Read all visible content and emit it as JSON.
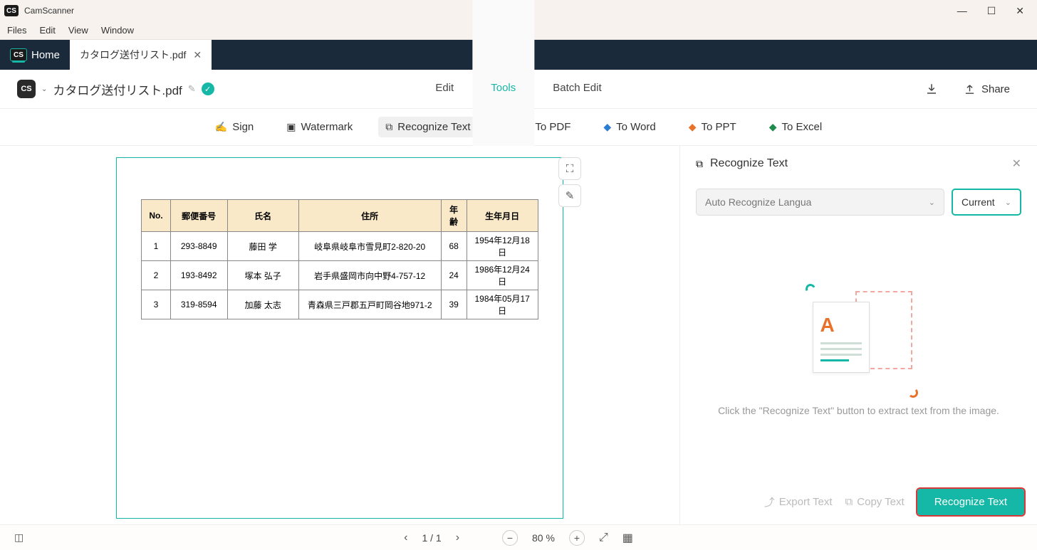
{
  "app": {
    "name": "CamScanner"
  },
  "menu": {
    "files": "Files",
    "edit": "Edit",
    "view": "View",
    "window": "Window"
  },
  "tabs": {
    "home": "Home",
    "doc": "カタログ送付リスト.pdf"
  },
  "toolbar": {
    "docTitle": "カタログ送付リスト.pdf",
    "edit": "Edit",
    "tools": "Tools",
    "batch": "Batch Edit",
    "share": "Share"
  },
  "ribbon": {
    "sign": "Sign",
    "watermark": "Watermark",
    "recognize": "Recognize Text",
    "toPdf": "To PDF",
    "toWord": "To Word",
    "toPpt": "To PPT",
    "toExcel": "To Excel"
  },
  "docTable": {
    "headers": {
      "no": "No.",
      "zip": "郵便番号",
      "name": "氏名",
      "addr": "住所",
      "age": "年齢",
      "dob": "生年月日"
    },
    "rows": [
      {
        "no": "1",
        "zip": "293-8849",
        "name": "藤田 学",
        "addr": "岐阜県岐阜市雪見町2-820-20",
        "age": "68",
        "dob": "1954年12月18日"
      },
      {
        "no": "2",
        "zip": "193-8492",
        "name": "塚本 弘子",
        "addr": "岩手県盛岡市向中野4-757-12",
        "age": "24",
        "dob": "1986年12月24日"
      },
      {
        "no": "3",
        "zip": "319-8594",
        "name": "加藤 太志",
        "addr": "青森県三戸郡五戸町岡谷地971-2",
        "age": "39",
        "dob": "1984年05月17日"
      }
    ]
  },
  "panel": {
    "title": "Recognize Text",
    "langDropdown": "Auto Recognize Langua",
    "pageDropdown": "Current",
    "hint": "Click the \"Recognize Text\" button to extract text from the image.",
    "exportText": "Export Text",
    "copyText": "Copy Text",
    "recognizeBtn": "Recognize Text"
  },
  "status": {
    "pageInfo": "1 / 1",
    "zoom": "80 %"
  }
}
